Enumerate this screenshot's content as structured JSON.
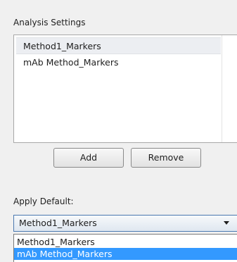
{
  "analysis_settings": {
    "label": "Analysis Settings",
    "items": [
      {
        "label": "Method1_Markers",
        "selected": true
      },
      {
        "label": "mAb Method_Markers",
        "selected": false
      }
    ],
    "add_label": "Add",
    "remove_label": "Remove"
  },
  "apply_default": {
    "label": "Apply Default:",
    "selected_value": "Method1_Markers",
    "options": [
      {
        "label": "Method1_Markers",
        "highlighted": false
      },
      {
        "label": "mAb Method_Markers",
        "highlighted": true
      }
    ]
  },
  "colors": {
    "highlight": "#3399ff",
    "dropdown_border": "#4a78b0"
  }
}
